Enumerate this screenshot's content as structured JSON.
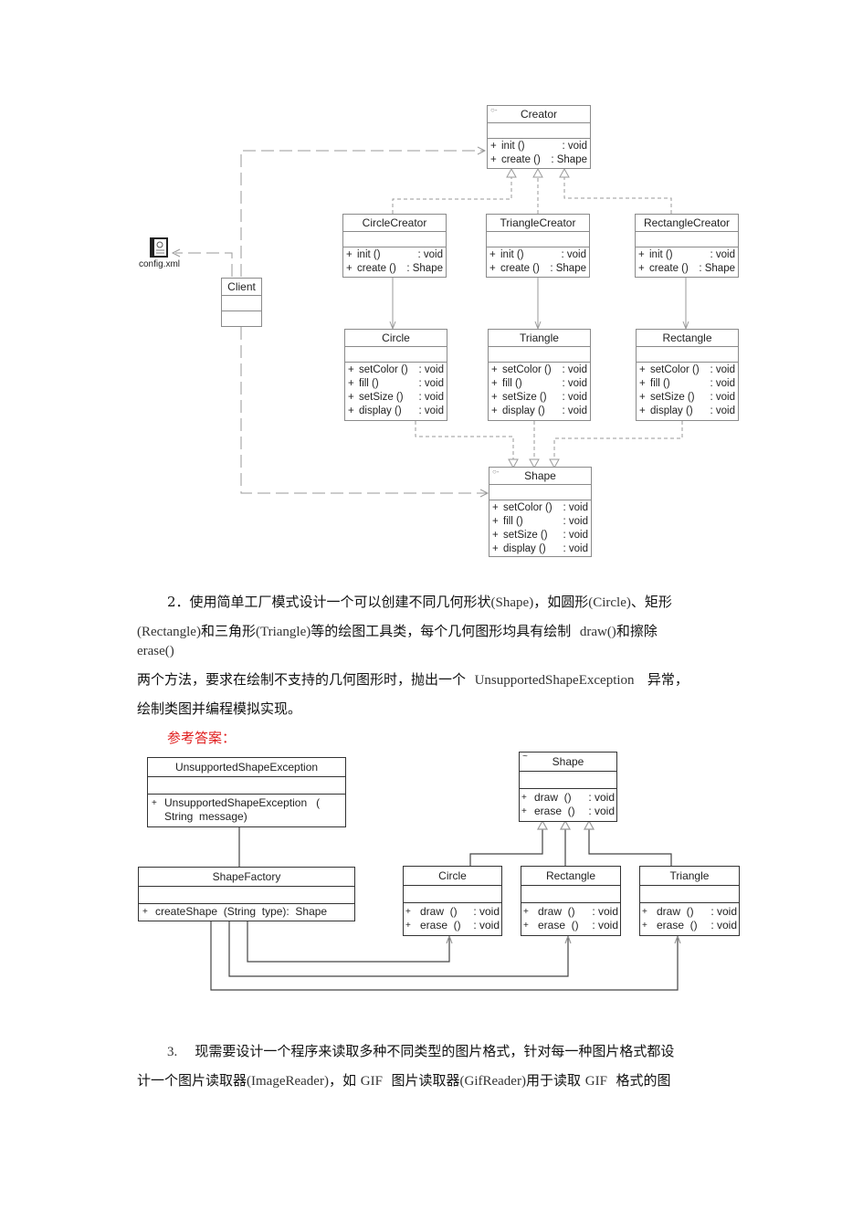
{
  "diagram1": {
    "config_file": {
      "label": "config.xml",
      "icon": "xml-file-icon"
    },
    "client": {
      "name": "Client"
    },
    "creator": {
      "name": "Creator",
      "stereotype": "○-",
      "ops": [
        {
          "vis": "+",
          "name": "init ()",
          "ret": ": void"
        },
        {
          "vis": "+",
          "name": "create ()",
          "ret": ": Shape"
        }
      ]
    },
    "concrete_creators": [
      {
        "name": "CircleCreator",
        "ops": [
          {
            "vis": "+",
            "name": "init ()",
            "ret": ": void"
          },
          {
            "vis": "+",
            "name": "create ()",
            "ret": ": Shape"
          }
        ]
      },
      {
        "name": "TriangleCreator",
        "ops": [
          {
            "vis": "+",
            "name": "init ()",
            "ret": ": void"
          },
          {
            "vis": "+",
            "name": "create ()",
            "ret": ": Shape"
          }
        ]
      },
      {
        "name": "RectangleCreator",
        "ops": [
          {
            "vis": "+",
            "name": "init ()",
            "ret": ": void"
          },
          {
            "vis": "+",
            "name": "create ()",
            "ret": ": Shape"
          }
        ]
      }
    ],
    "products": [
      {
        "name": "Circle",
        "ops": [
          {
            "vis": "+",
            "name": "setColor ()",
            "ret": ": void"
          },
          {
            "vis": "+",
            "name": "fill ()",
            "ret": ": void"
          },
          {
            "vis": "+",
            "name": "setSize ()",
            "ret": ": void"
          },
          {
            "vis": "+",
            "name": "display ()",
            "ret": ": void"
          }
        ]
      },
      {
        "name": "Triangle",
        "ops": [
          {
            "vis": "+",
            "name": "setColor ()",
            "ret": ": void"
          },
          {
            "vis": "+",
            "name": "fill ()",
            "ret": ": void"
          },
          {
            "vis": "+",
            "name": "setSize ()",
            "ret": ": void"
          },
          {
            "vis": "+",
            "name": "display ()",
            "ret": ": void"
          }
        ]
      },
      {
        "name": "Rectangle",
        "ops": [
          {
            "vis": "+",
            "name": "setColor ()",
            "ret": ": void"
          },
          {
            "vis": "+",
            "name": "fill ()",
            "ret": ": void"
          },
          {
            "vis": "+",
            "name": "setSize ()",
            "ret": ": void"
          },
          {
            "vis": "+",
            "name": "display ()",
            "ret": ": void"
          }
        ]
      }
    ],
    "shape": {
      "name": "Shape",
      "stereotype": "○-",
      "ops": [
        {
          "vis": "+",
          "name": "setColor ()",
          "ret": ": void"
        },
        {
          "vis": "+",
          "name": "fill ()",
          "ret": ": void"
        },
        {
          "vis": "+",
          "name": "setSize ()",
          "ret": ": void"
        },
        {
          "vis": "+",
          "name": "display ()",
          "ret": ": void"
        }
      ]
    }
  },
  "question2": {
    "line1_prefix": "2．使用简单工厂模式设计一个可以创建不同几何形状",
    "line1_shape": "(Shape)",
    "line1_mid": "，如圆形",
    "line1_circle": "(Circle)",
    "line1_end": "、矩形",
    "line2_rect": "(Rectangle)",
    "line2_mid1": "和三角形",
    "line2_tri": "(Triangle)",
    "line2_mid2": "等的绘图工具类，每个几何图形均具有绘制",
    "line2_draw": "draw()",
    "line2_end": "和擦除",
    "line3": "erase()",
    "line4_prefix": "两个方法，要求在绘制不支持的几何图形时，抛出一个",
    "line4_exc": "UnsupportedShapeException",
    "line4_end": "异常，",
    "line5": "绘制类图并编程模拟实现。",
    "answer_label": "参考答案："
  },
  "diagram2": {
    "exception": {
      "name": "UnsupportedShapeException",
      "op_line1": "UnsupportedShapeException   (",
      "op_line2": "String  message)",
      "vis": "+"
    },
    "factory": {
      "name": "ShapeFactory",
      "op": "createShape  (String  type):  Shape",
      "vis": "+"
    },
    "shape": {
      "name": "Shape",
      "stereotype": "~",
      "ops": [
        {
          "vis": "+",
          "name": "draw  ()",
          "ret": ": void"
        },
        {
          "vis": "+",
          "name": "erase  ()",
          "ret": ": void"
        }
      ]
    },
    "products": [
      {
        "name": "Circle",
        "ops": [
          {
            "vis": "+",
            "name": "draw  ()",
            "ret": ": void"
          },
          {
            "vis": "+",
            "name": "erase  ()",
            "ret": ": void"
          }
        ]
      },
      {
        "name": "Rectangle",
        "ops": [
          {
            "vis": "+",
            "name": "draw  ()",
            "ret": ": void"
          },
          {
            "vis": "+",
            "name": "erase  ()",
            "ret": ": void"
          }
        ]
      },
      {
        "name": "Triangle",
        "ops": [
          {
            "vis": "+",
            "name": "draw  ()",
            "ret": ": void"
          },
          {
            "vis": "+",
            "name": "erase  ()",
            "ret": ": void"
          }
        ]
      }
    ]
  },
  "question3": {
    "line1_num": "3.",
    "line1_text": "现需要设计一个程序来读取多种不同类型的图片格式，针对每一种图片格式都设",
    "line2_a": "计一个图片读取器",
    "line2_b": "(ImageReader)",
    "line2_c": "，如",
    "line2_d": "GIF",
    "line2_e": "图片读取器",
    "line2_f": "(GifReader)",
    "line2_g": "用于读取",
    "line2_h": "GIF",
    "line2_i": "格式的图"
  },
  "colors": {
    "answer": "#e02020",
    "uml_gray": "#8a8a8a",
    "uml_black": "#333333"
  }
}
